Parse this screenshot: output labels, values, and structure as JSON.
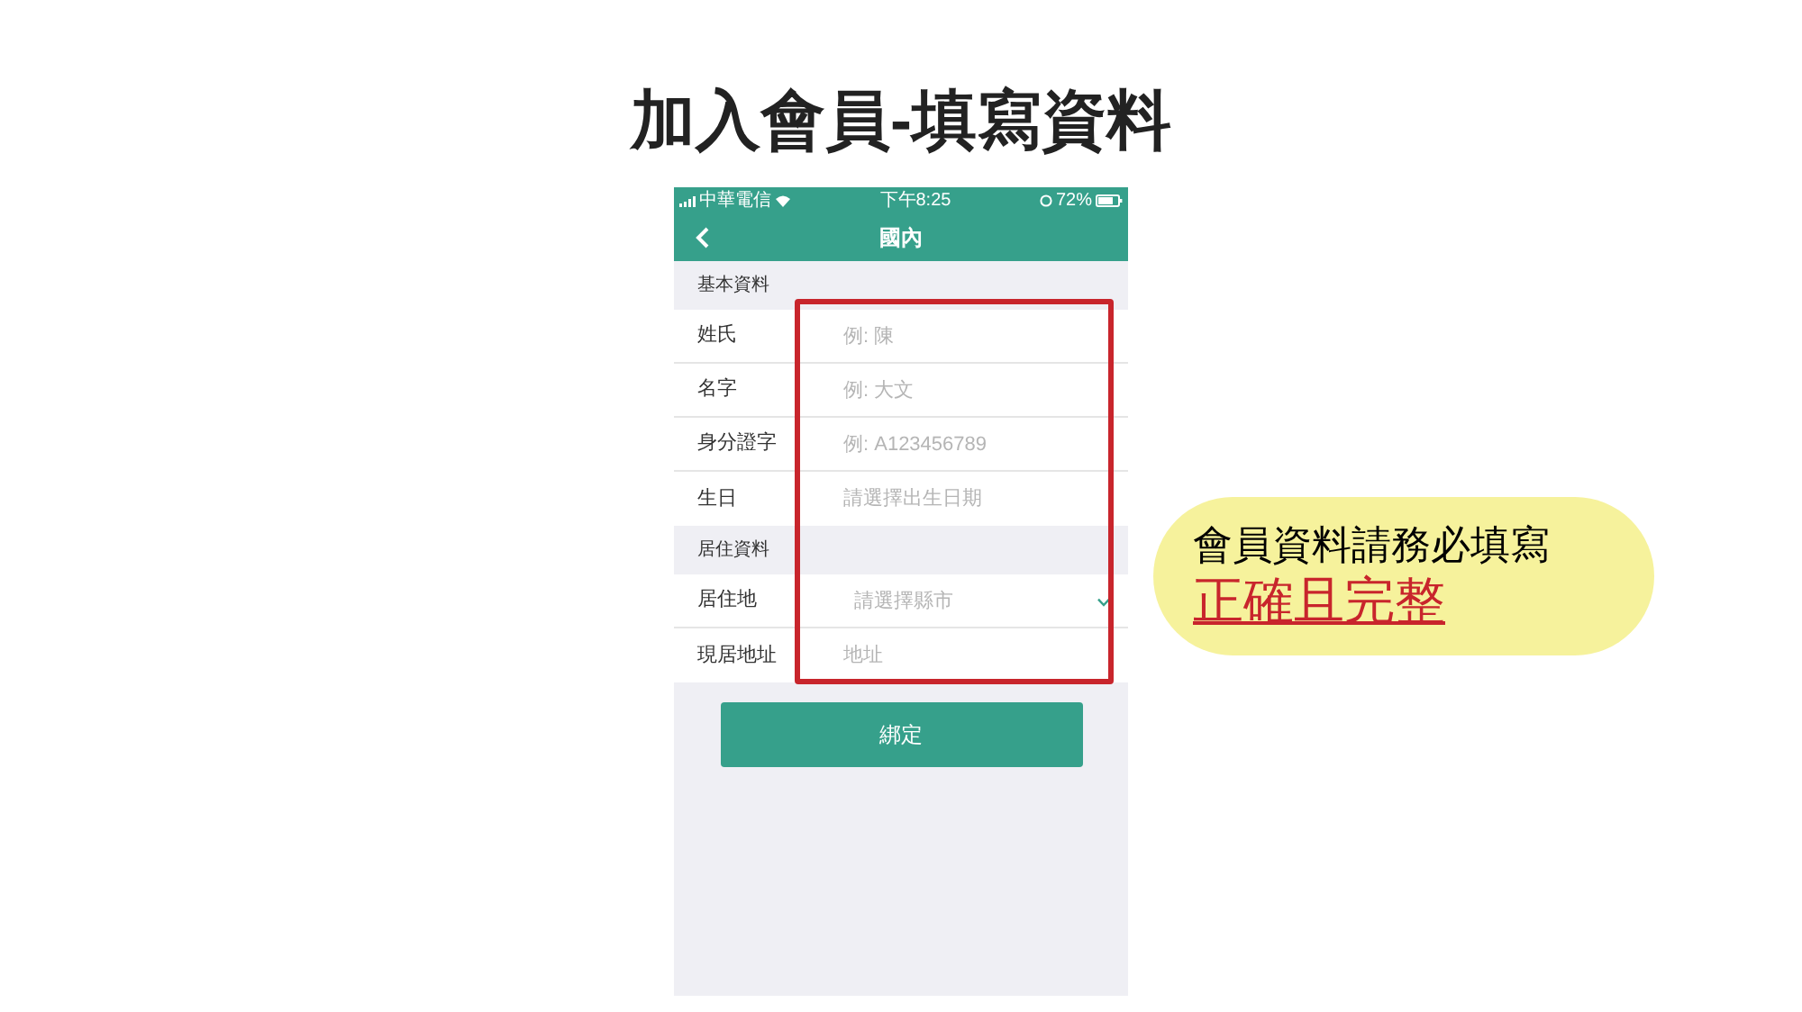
{
  "title": "加入會員-填寫資料",
  "phone": {
    "status_bar": {
      "carrier": "中華電信",
      "time": "下午8:25",
      "battery": "72%"
    },
    "nav": {
      "title": "國內"
    },
    "sections": [
      {
        "header": "基本資料",
        "rows": [
          {
            "label": "姓氏",
            "placeholder": "例: 陳",
            "kind": "text"
          },
          {
            "label": "名字",
            "placeholder": "例: 大文",
            "kind": "text"
          },
          {
            "label": "身分證字",
            "placeholder": "例: A123456789",
            "kind": "text"
          },
          {
            "label": "生日",
            "placeholder": "請選擇出生日期",
            "kind": "text"
          }
        ]
      },
      {
        "header": "居住資料",
        "rows": [
          {
            "label": "居住地",
            "placeholder": "請選擇縣市",
            "kind": "select"
          },
          {
            "label": "現居地址",
            "placeholder": "地址",
            "kind": "text"
          }
        ]
      }
    ],
    "button": "綁定"
  },
  "callout": {
    "text": "會員資料請務必填寫",
    "emphasis": "正確且完整"
  }
}
